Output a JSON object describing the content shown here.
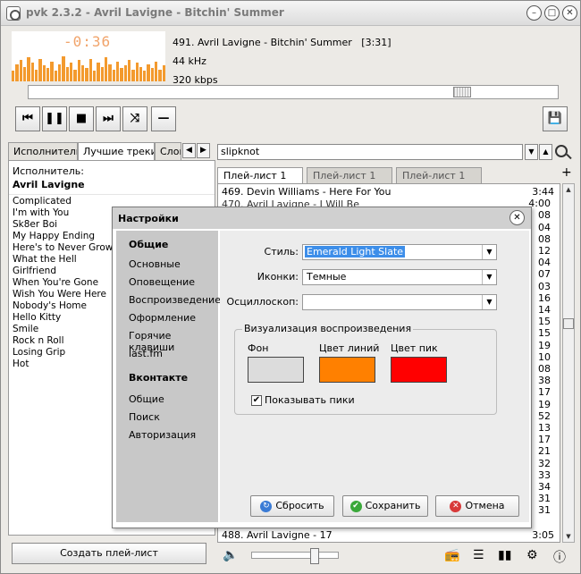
{
  "window": {
    "title": "pvk 2.3.2 - Avril Lavigne - Bitchin' Summer"
  },
  "player": {
    "time": "-0:36",
    "track_line": "491. Avril Lavigne - Bitchin' Summer",
    "duration": "[3:31]",
    "frequency": "44 kHz",
    "bitrate": "320 kbps",
    "seek_progress": 0.83,
    "accent_color": "#f39a2e"
  },
  "controls": [
    "prev-icon",
    "pause-icon",
    "stop-icon",
    "next-icon",
    "shuffle-icon",
    "minus-icon"
  ],
  "left": {
    "tabs": [
      "Исполнитель",
      "Лучшие треки",
      "Слов"
    ],
    "artist_label": "Исполнитель:",
    "artist_name": "Avril Lavigne",
    "songs": [
      "Complicated",
      "I'm with You",
      "Sk8er Boi",
      "My Happy Ending",
      "Here's to Never Growing Up",
      "What the Hell",
      "Girlfriend",
      "When You're Gone",
      "Wish You Were Here",
      "Nobody's Home",
      "Hello Kitty",
      "Smile",
      "Rock n Roll",
      "Losing Grip",
      "Hot"
    ],
    "create_button": "Создать плей-лист"
  },
  "search": {
    "value": "slipknot"
  },
  "playlist": {
    "tabs": [
      "Плей-лист 1",
      "Плей-лист 1",
      "Плей-лист 1"
    ],
    "first_row": {
      "text": "469. Devin Williams - Here For You",
      "time": "3:44"
    },
    "partial_row_2": "470. Avril Lavigne - I Will Be",
    "partial_time_2": "4:00",
    "last_row": "488. Avril Lavigne - 17",
    "visible_times": [
      "3:44",
      "4:00",
      "08",
      "04",
      "08",
      "12",
      "04",
      "07",
      "03",
      "16",
      "14",
      "15",
      "15",
      "19",
      "10",
      "08",
      "38",
      "17",
      "19",
      "52",
      "13",
      "17",
      "21",
      "32",
      "33",
      "34",
      "31",
      "31"
    ],
    "last_time": "3:05"
  },
  "volume": {
    "level": 0.74
  },
  "dialog": {
    "title": "Настройки",
    "sections": [
      {
        "heading": "Общие",
        "items": [
          "Основные",
          "Оповещение",
          "Воспроизведение",
          "Оформление",
          "Горячие клавиши",
          "last.fm"
        ]
      },
      {
        "heading": "Вконтакте",
        "items": [
          "Общие",
          "Поиск",
          "Авторизация"
        ]
      }
    ],
    "fields": [
      {
        "label": "Стиль:",
        "value": "Emerald Light Slate"
      },
      {
        "label": "Иконки:",
        "value": "Темные"
      },
      {
        "label": "Осциллоскоп:",
        "value": ""
      }
    ],
    "visual_group": {
      "title": "Визуализация воспроизведения",
      "colors": [
        {
          "label": "Фон",
          "color": "#dcdcdc"
        },
        {
          "label": "Цвет линий",
          "color": "#ff8000"
        },
        {
          "label": "Цвет пик",
          "color": "#ff0000"
        }
      ],
      "show_peaks_label": "Показывать пики",
      "show_peaks": true
    },
    "buttons": {
      "reset": "Сбросить",
      "save": "Сохранить",
      "cancel": "Отмена"
    }
  }
}
